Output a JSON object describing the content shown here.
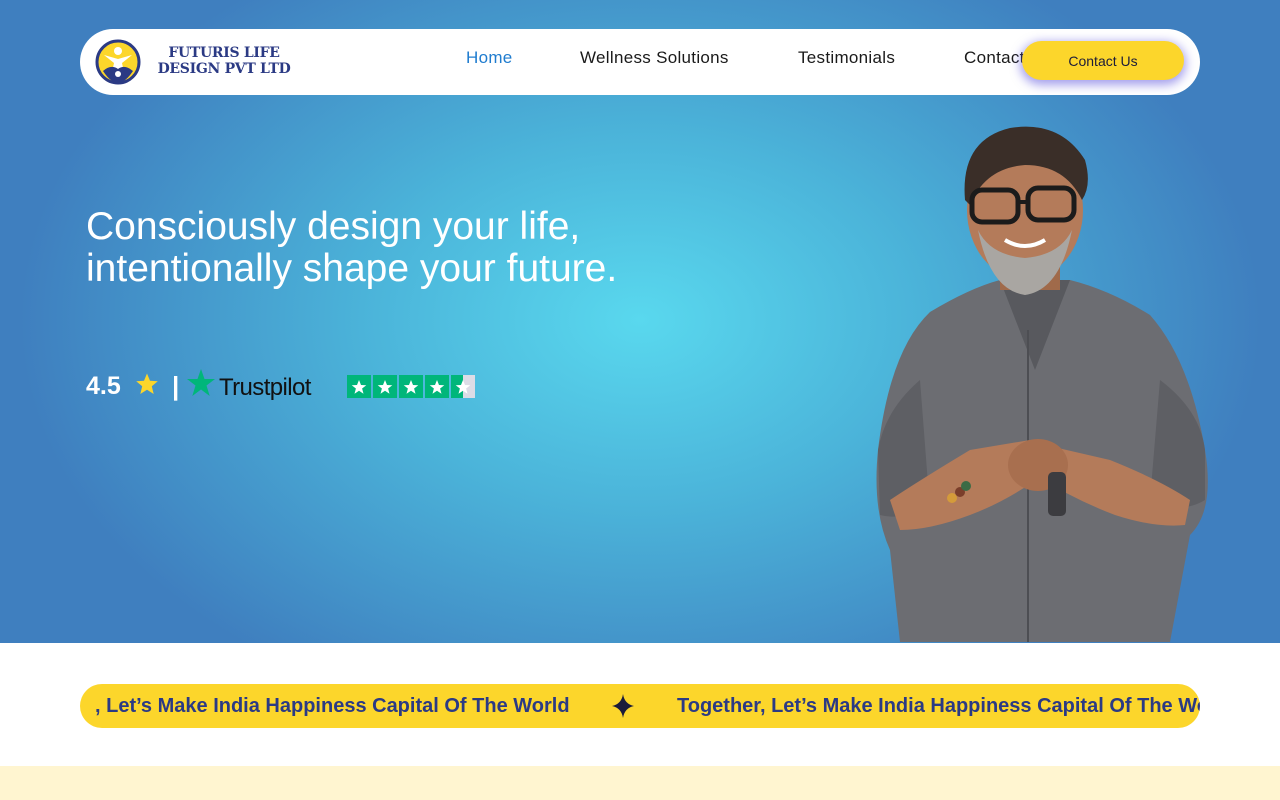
{
  "navbar": {
    "brand_line1": "FUTURIS LIFE",
    "brand_line2": "DESIGN PVT LTD",
    "items": [
      {
        "label": "Home",
        "active": true
      },
      {
        "label": "Wellness Solutions",
        "active": false
      },
      {
        "label": "Testimonials",
        "active": false
      },
      {
        "label": "Contact",
        "active": false
      }
    ],
    "cta_label": "Contact Us"
  },
  "hero": {
    "headline_line1": "Consciously design your life,",
    "headline_line2": "intentionally shape your future.",
    "rating_value": "4.5",
    "rating_separator": "|",
    "trustpilot_label": "Trustpilot",
    "trustpilot_stars": 4.5,
    "trustpilot_max": 5
  },
  "ticker": {
    "text_1": ", Let’s Make India Happiness Capital Of The World",
    "text_2": "Together, Let’s Make India Happiness Capital Of The World"
  },
  "colors": {
    "brand_navy": "#2b3a84",
    "accent_yellow": "#fcd62b",
    "nav_active": "#1f7ccf",
    "trustpilot_green": "#00b67a",
    "hero_gradient_center": "#59d8ee",
    "hero_gradient_edge": "#3f7fbf",
    "footer_band": "#fff5d0"
  },
  "icons": {
    "logo": "futuris-logo-icon",
    "rating_star": "star-icon",
    "trustpilot": "trustpilot-star-icon",
    "ticker_separator": "sparkle-icon"
  }
}
